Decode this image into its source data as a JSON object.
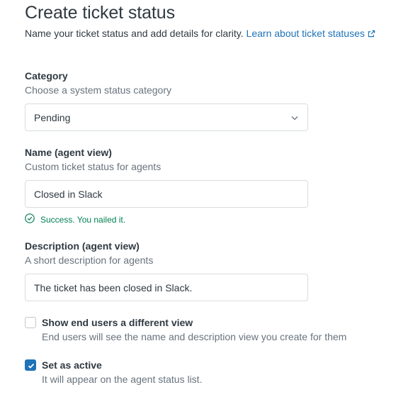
{
  "header": {
    "title": "Create ticket status",
    "subtitle": "Name your ticket status and add details for clarity.",
    "learn_link": "Learn about ticket statuses"
  },
  "category": {
    "label": "Category",
    "hint": "Choose a system status category",
    "selected": "Pending"
  },
  "name_field": {
    "label": "Name (agent view)",
    "hint": "Custom ticket status for agents",
    "value": "Closed in Slack",
    "success_message": "Success. You nailed it."
  },
  "description_field": {
    "label": "Description (agent view)",
    "hint": "A short description for agents",
    "value": "The ticket has been closed in Slack."
  },
  "end_user_view": {
    "label": "Show end users a different view",
    "hint": "End users will see the name and description view you create for them",
    "checked": false
  },
  "active": {
    "label": "Set as active",
    "hint": "It will appear on the agent status list.",
    "checked": true
  },
  "colors": {
    "link": "#1f73b7",
    "success": "#038153",
    "checkbox_checked": "#1f73b7"
  },
  "icons": {
    "external_link": "external-link-icon",
    "chevron": "chevron-down-icon",
    "success": "check-circle-icon",
    "checkmark": "checkmark-icon"
  }
}
